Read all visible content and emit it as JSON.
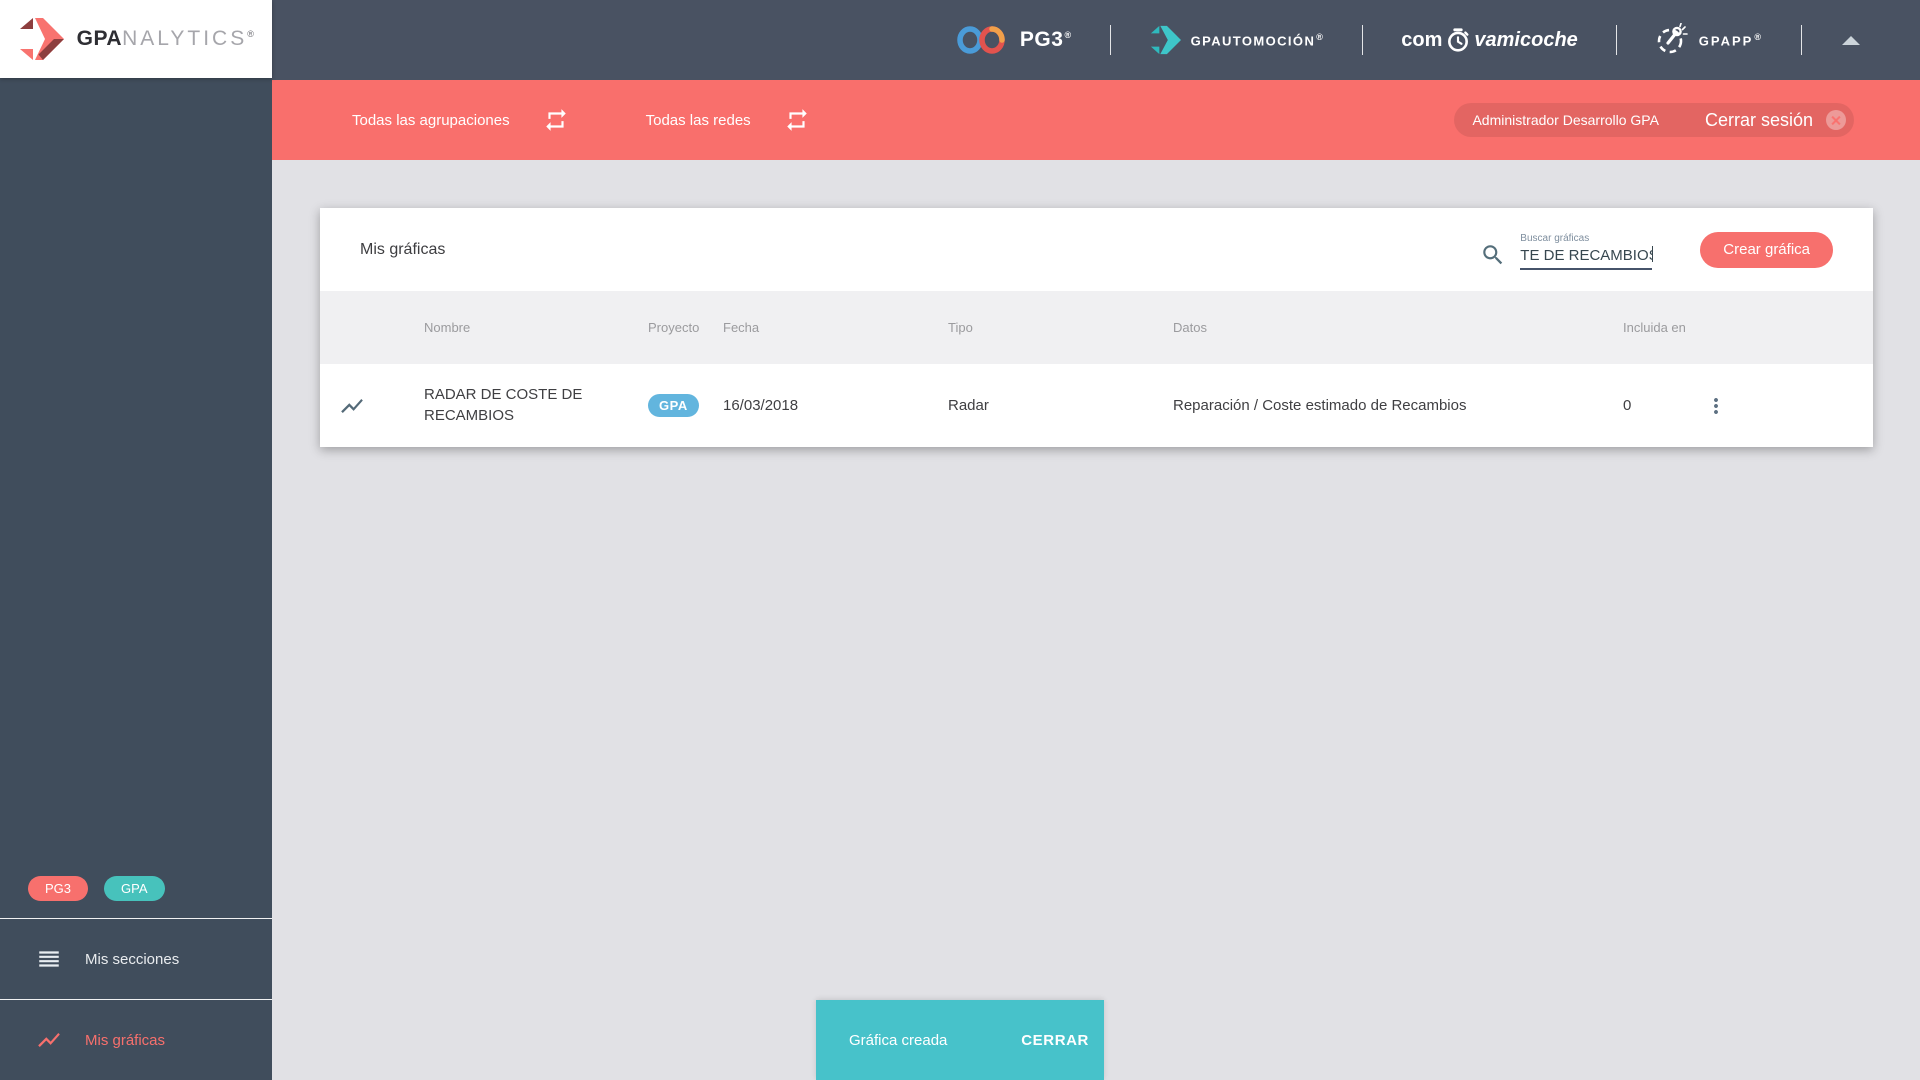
{
  "brand": {
    "bold": "GPA",
    "light": "NALYTICS",
    "reg": "®"
  },
  "header": {
    "pg3_label": "PG3",
    "pg3_reg": "®",
    "gpautomocion_label": "GPAUTOMOCIÓN",
    "gpautomocion_reg": "®",
    "comova_pre": "com",
    "comova_post": "vamicoche",
    "gpapp_label": "GPAPP",
    "gpapp_reg": "®"
  },
  "filter_bar": {
    "groupings_label": "Todas las agrupaciones",
    "networks_label": "Todas las redes",
    "user_label": "Administrador Desarrollo GPA",
    "logout_label": "Cerrar sesión"
  },
  "sidebar": {
    "badges": [
      {
        "label": "PG3"
      },
      {
        "label": "GPA"
      }
    ],
    "items": [
      {
        "label": "Mis secciones"
      },
      {
        "label": "Mis gráficas"
      }
    ]
  },
  "card": {
    "title": "Mis gráficas",
    "search": {
      "label": "Buscar gráficas",
      "value": "TE DE RECAMBIOS"
    },
    "create_button": "Crear gráfica"
  },
  "table": {
    "columns": [
      "Nombre",
      "Proyecto",
      "Fecha",
      "Tipo",
      "Datos",
      "Incluida en"
    ],
    "rows": [
      {
        "name": "RADAR DE COSTE DE RECAMBIOS",
        "project_badge": "GPA",
        "date": "16/03/2018",
        "type": "Radar",
        "data": "Reparación / Coste estimado de Recambios",
        "included_in": "0"
      }
    ]
  },
  "snackbar": {
    "message": "Gráfica creada",
    "action": "CERRAR"
  },
  "colors": {
    "accent_red": "#f7706d",
    "bar_red": "#f96f6c",
    "teal": "#47c2bc",
    "snackbar_teal": "#47c2ca",
    "badge_blue": "#62b5de",
    "dark_header": "#495262",
    "sidebar_dark": "#404d5c"
  }
}
